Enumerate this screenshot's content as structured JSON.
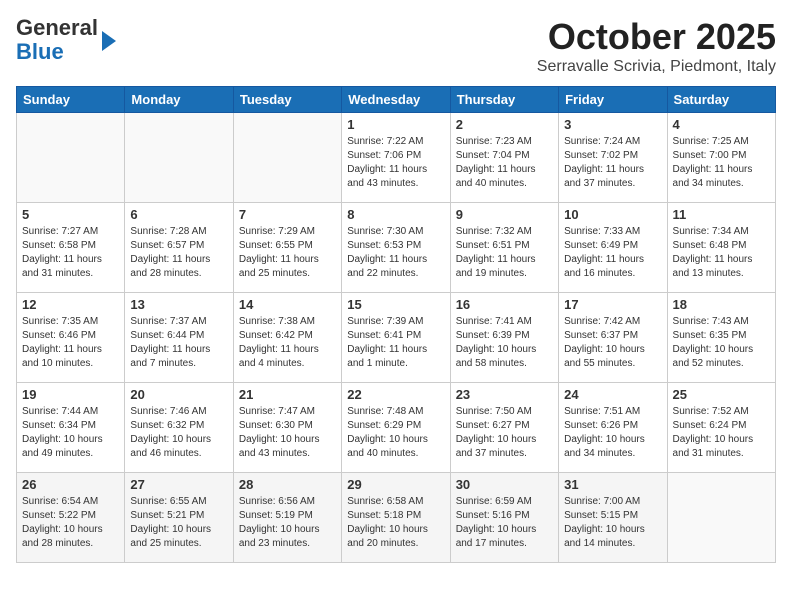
{
  "header": {
    "logo_line1": "General",
    "logo_line2": "Blue",
    "month": "October 2025",
    "location": "Serravalle Scrivia, Piedmont, Italy"
  },
  "days_of_week": [
    "Sunday",
    "Monday",
    "Tuesday",
    "Wednesday",
    "Thursday",
    "Friday",
    "Saturday"
  ],
  "weeks": [
    [
      {
        "day": "",
        "info": ""
      },
      {
        "day": "",
        "info": ""
      },
      {
        "day": "",
        "info": ""
      },
      {
        "day": "1",
        "info": "Sunrise: 7:22 AM\nSunset: 7:06 PM\nDaylight: 11 hours\nand 43 minutes."
      },
      {
        "day": "2",
        "info": "Sunrise: 7:23 AM\nSunset: 7:04 PM\nDaylight: 11 hours\nand 40 minutes."
      },
      {
        "day": "3",
        "info": "Sunrise: 7:24 AM\nSunset: 7:02 PM\nDaylight: 11 hours\nand 37 minutes."
      },
      {
        "day": "4",
        "info": "Sunrise: 7:25 AM\nSunset: 7:00 PM\nDaylight: 11 hours\nand 34 minutes."
      }
    ],
    [
      {
        "day": "5",
        "info": "Sunrise: 7:27 AM\nSunset: 6:58 PM\nDaylight: 11 hours\nand 31 minutes."
      },
      {
        "day": "6",
        "info": "Sunrise: 7:28 AM\nSunset: 6:57 PM\nDaylight: 11 hours\nand 28 minutes."
      },
      {
        "day": "7",
        "info": "Sunrise: 7:29 AM\nSunset: 6:55 PM\nDaylight: 11 hours\nand 25 minutes."
      },
      {
        "day": "8",
        "info": "Sunrise: 7:30 AM\nSunset: 6:53 PM\nDaylight: 11 hours\nand 22 minutes."
      },
      {
        "day": "9",
        "info": "Sunrise: 7:32 AM\nSunset: 6:51 PM\nDaylight: 11 hours\nand 19 minutes."
      },
      {
        "day": "10",
        "info": "Sunrise: 7:33 AM\nSunset: 6:49 PM\nDaylight: 11 hours\nand 16 minutes."
      },
      {
        "day": "11",
        "info": "Sunrise: 7:34 AM\nSunset: 6:48 PM\nDaylight: 11 hours\nand 13 minutes."
      }
    ],
    [
      {
        "day": "12",
        "info": "Sunrise: 7:35 AM\nSunset: 6:46 PM\nDaylight: 11 hours\nand 10 minutes."
      },
      {
        "day": "13",
        "info": "Sunrise: 7:37 AM\nSunset: 6:44 PM\nDaylight: 11 hours\nand 7 minutes."
      },
      {
        "day": "14",
        "info": "Sunrise: 7:38 AM\nSunset: 6:42 PM\nDaylight: 11 hours\nand 4 minutes."
      },
      {
        "day": "15",
        "info": "Sunrise: 7:39 AM\nSunset: 6:41 PM\nDaylight: 11 hours\nand 1 minute."
      },
      {
        "day": "16",
        "info": "Sunrise: 7:41 AM\nSunset: 6:39 PM\nDaylight: 10 hours\nand 58 minutes."
      },
      {
        "day": "17",
        "info": "Sunrise: 7:42 AM\nSunset: 6:37 PM\nDaylight: 10 hours\nand 55 minutes."
      },
      {
        "day": "18",
        "info": "Sunrise: 7:43 AM\nSunset: 6:35 PM\nDaylight: 10 hours\nand 52 minutes."
      }
    ],
    [
      {
        "day": "19",
        "info": "Sunrise: 7:44 AM\nSunset: 6:34 PM\nDaylight: 10 hours\nand 49 minutes."
      },
      {
        "day": "20",
        "info": "Sunrise: 7:46 AM\nSunset: 6:32 PM\nDaylight: 10 hours\nand 46 minutes."
      },
      {
        "day": "21",
        "info": "Sunrise: 7:47 AM\nSunset: 6:30 PM\nDaylight: 10 hours\nand 43 minutes."
      },
      {
        "day": "22",
        "info": "Sunrise: 7:48 AM\nSunset: 6:29 PM\nDaylight: 10 hours\nand 40 minutes."
      },
      {
        "day": "23",
        "info": "Sunrise: 7:50 AM\nSunset: 6:27 PM\nDaylight: 10 hours\nand 37 minutes."
      },
      {
        "day": "24",
        "info": "Sunrise: 7:51 AM\nSunset: 6:26 PM\nDaylight: 10 hours\nand 34 minutes."
      },
      {
        "day": "25",
        "info": "Sunrise: 7:52 AM\nSunset: 6:24 PM\nDaylight: 10 hours\nand 31 minutes."
      }
    ],
    [
      {
        "day": "26",
        "info": "Sunrise: 6:54 AM\nSunset: 5:22 PM\nDaylight: 10 hours\nand 28 minutes."
      },
      {
        "day": "27",
        "info": "Sunrise: 6:55 AM\nSunset: 5:21 PM\nDaylight: 10 hours\nand 25 minutes."
      },
      {
        "day": "28",
        "info": "Sunrise: 6:56 AM\nSunset: 5:19 PM\nDaylight: 10 hours\nand 23 minutes."
      },
      {
        "day": "29",
        "info": "Sunrise: 6:58 AM\nSunset: 5:18 PM\nDaylight: 10 hours\nand 20 minutes."
      },
      {
        "day": "30",
        "info": "Sunrise: 6:59 AM\nSunset: 5:16 PM\nDaylight: 10 hours\nand 17 minutes."
      },
      {
        "day": "31",
        "info": "Sunrise: 7:00 AM\nSunset: 5:15 PM\nDaylight: 10 hours\nand 14 minutes."
      },
      {
        "day": "",
        "info": ""
      }
    ]
  ]
}
